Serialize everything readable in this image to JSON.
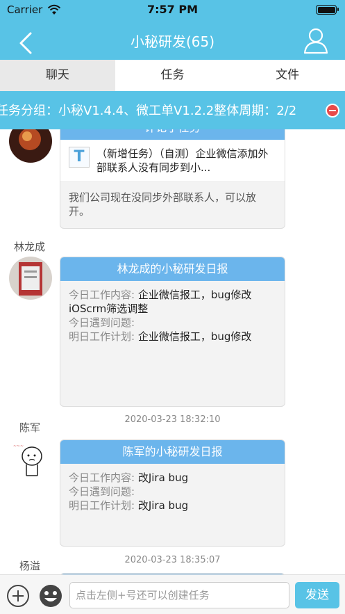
{
  "status": {
    "carrier": "Carrier",
    "time": "7:57 PM"
  },
  "header": {
    "title": "小秘研发(65)"
  },
  "tabs": [
    {
      "label": "聊天",
      "active": true
    },
    {
      "label": "任务"
    },
    {
      "label": "文件"
    }
  ],
  "marquee": {
    "text": "任务分组：小秘V1.4.4、微工单V1.2.2整体周期：2/2"
  },
  "messages": {
    "task_card": {
      "head": "评论了任务",
      "task_text": "（新增任务）（自测）企业微信添加外部联系人没有同步到小...",
      "reply": "我们公司现在没同步外部联系人，可以放开。"
    },
    "m1": {
      "sender": "林龙成",
      "title": "林龙成的小秘研发日报",
      "lbl_today": "今日工作内容:",
      "today": " 企业微信报工，bug修改",
      "today_extra": "iOScrm筛选调整",
      "lbl_issue": "今日遇到问题:",
      "issue": "",
      "lbl_plan": "明日工作计划:",
      "plan": " 企业微信报工，bug修改"
    },
    "ts1": "2020-03-23 18:32:10",
    "m2": {
      "sender": "陈军",
      "title": "陈军的小秘研发日报",
      "lbl_today": "今日工作内容:",
      "today": " 改Jira bug",
      "lbl_issue": "今日遇到问题:",
      "issue": "",
      "lbl_plan": "明日工作计划:",
      "plan": " 改Jira bug"
    },
    "ts2": "2020-03-23 18:35:07",
    "m3": {
      "sender": "杨溢"
    }
  },
  "input": {
    "placeholder": "点击左侧+号还可以创建任务",
    "send_label": "发送"
  },
  "colors": {
    "accent": "#58c3e6",
    "card_header": "#6bb5ec",
    "close": "#e84a4a"
  }
}
